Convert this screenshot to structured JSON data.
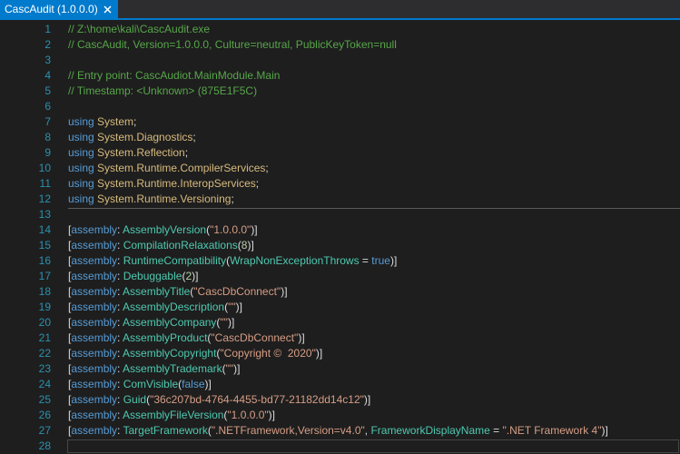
{
  "tab": {
    "title": "CascAudit (1.0.0.0)",
    "close_glyph": "✕"
  },
  "colors": {
    "accent": "#007acc",
    "background": "#1e1e1e",
    "line_number": "#2b91af",
    "comment": "#57a64a",
    "keyword": "#569cd6",
    "namespace": "#d7ba7d",
    "type": "#4ec9b0",
    "string": "#d69d85",
    "number": "#b5cea8",
    "text": "#dcdcdc"
  },
  "lines": [
    {
      "n": "1",
      "tokens": [
        {
          "c": "comment",
          "t": "// Z:\\home\\kali\\CascAudit.exe"
        }
      ]
    },
    {
      "n": "2",
      "tokens": [
        {
          "c": "comment",
          "t": "// CascAudit, Version=1.0.0.0, Culture=neutral, PublicKeyToken=null"
        }
      ]
    },
    {
      "n": "3",
      "tokens": []
    },
    {
      "n": "4",
      "tokens": [
        {
          "c": "comment",
          "t": "// Entry point: CascAudiot.MainModule.Main"
        }
      ]
    },
    {
      "n": "5",
      "tokens": [
        {
          "c": "comment",
          "t": "// Timestamp: <Unknown> (875E1F5C)"
        }
      ]
    },
    {
      "n": "6",
      "tokens": []
    },
    {
      "n": "7",
      "tokens": [
        {
          "c": "kw",
          "t": "using"
        },
        {
          "c": "text",
          "t": " "
        },
        {
          "c": "ns",
          "t": "System"
        },
        {
          "c": "text",
          "t": ";"
        }
      ]
    },
    {
      "n": "8",
      "tokens": [
        {
          "c": "kw",
          "t": "using"
        },
        {
          "c": "text",
          "t": " "
        },
        {
          "c": "ns",
          "t": "System.Diagnostics"
        },
        {
          "c": "text",
          "t": ";"
        }
      ]
    },
    {
      "n": "9",
      "tokens": [
        {
          "c": "kw",
          "t": "using"
        },
        {
          "c": "text",
          "t": " "
        },
        {
          "c": "ns",
          "t": "System.Reflection"
        },
        {
          "c": "text",
          "t": ";"
        }
      ]
    },
    {
      "n": "10",
      "tokens": [
        {
          "c": "kw",
          "t": "using"
        },
        {
          "c": "text",
          "t": " "
        },
        {
          "c": "ns",
          "t": "System.Runtime.CompilerServices"
        },
        {
          "c": "text",
          "t": ";"
        }
      ]
    },
    {
      "n": "11",
      "tokens": [
        {
          "c": "kw",
          "t": "using"
        },
        {
          "c": "text",
          "t": " "
        },
        {
          "c": "ns",
          "t": "System.Runtime.InteropServices"
        },
        {
          "c": "text",
          "t": ";"
        }
      ]
    },
    {
      "n": "12",
      "tokens": [
        {
          "c": "kw",
          "t": "using"
        },
        {
          "c": "text",
          "t": " "
        },
        {
          "c": "ns",
          "t": "System.Runtime.Versioning"
        },
        {
          "c": "text",
          "t": ";"
        }
      ]
    },
    {
      "n": "13",
      "tokens": []
    },
    {
      "n": "14",
      "tokens": [
        {
          "c": "text",
          "t": "["
        },
        {
          "c": "kw",
          "t": "assembly"
        },
        {
          "c": "text",
          "t": ": "
        },
        {
          "c": "type",
          "t": "AssemblyVersion"
        },
        {
          "c": "text",
          "t": "("
        },
        {
          "c": "str",
          "t": "\"1.0.0.0\""
        },
        {
          "c": "text",
          "t": ")]"
        }
      ]
    },
    {
      "n": "15",
      "tokens": [
        {
          "c": "text",
          "t": "["
        },
        {
          "c": "kw",
          "t": "assembly"
        },
        {
          "c": "text",
          "t": ": "
        },
        {
          "c": "type",
          "t": "CompilationRelaxations"
        },
        {
          "c": "text",
          "t": "("
        },
        {
          "c": "num",
          "t": "8"
        },
        {
          "c": "text",
          "t": ")]"
        }
      ]
    },
    {
      "n": "16",
      "tokens": [
        {
          "c": "text",
          "t": "["
        },
        {
          "c": "kw",
          "t": "assembly"
        },
        {
          "c": "text",
          "t": ": "
        },
        {
          "c": "type",
          "t": "RuntimeCompatibility"
        },
        {
          "c": "text",
          "t": "("
        },
        {
          "c": "type",
          "t": "WrapNonExceptionThrows"
        },
        {
          "c": "text",
          "t": " = "
        },
        {
          "c": "kw",
          "t": "true"
        },
        {
          "c": "text",
          "t": ")]"
        }
      ]
    },
    {
      "n": "17",
      "tokens": [
        {
          "c": "text",
          "t": "["
        },
        {
          "c": "kw",
          "t": "assembly"
        },
        {
          "c": "text",
          "t": ": "
        },
        {
          "c": "type",
          "t": "Debuggable"
        },
        {
          "c": "text",
          "t": "("
        },
        {
          "c": "num",
          "t": "2"
        },
        {
          "c": "text",
          "t": ")]"
        }
      ]
    },
    {
      "n": "18",
      "tokens": [
        {
          "c": "text",
          "t": "["
        },
        {
          "c": "kw",
          "t": "assembly"
        },
        {
          "c": "text",
          "t": ": "
        },
        {
          "c": "type",
          "t": "AssemblyTitle"
        },
        {
          "c": "text",
          "t": "("
        },
        {
          "c": "str",
          "t": "\"CascDbConnect\""
        },
        {
          "c": "text",
          "t": ")]"
        }
      ]
    },
    {
      "n": "19",
      "tokens": [
        {
          "c": "text",
          "t": "["
        },
        {
          "c": "kw",
          "t": "assembly"
        },
        {
          "c": "text",
          "t": ": "
        },
        {
          "c": "type",
          "t": "AssemblyDescription"
        },
        {
          "c": "text",
          "t": "("
        },
        {
          "c": "str",
          "t": "\"\""
        },
        {
          "c": "text",
          "t": ")]"
        }
      ]
    },
    {
      "n": "20",
      "tokens": [
        {
          "c": "text",
          "t": "["
        },
        {
          "c": "kw",
          "t": "assembly"
        },
        {
          "c": "text",
          "t": ": "
        },
        {
          "c": "type",
          "t": "AssemblyCompany"
        },
        {
          "c": "text",
          "t": "("
        },
        {
          "c": "str",
          "t": "\"\""
        },
        {
          "c": "text",
          "t": ")]"
        }
      ]
    },
    {
      "n": "21",
      "tokens": [
        {
          "c": "text",
          "t": "["
        },
        {
          "c": "kw",
          "t": "assembly"
        },
        {
          "c": "text",
          "t": ": "
        },
        {
          "c": "type",
          "t": "AssemblyProduct"
        },
        {
          "c": "text",
          "t": "("
        },
        {
          "c": "str",
          "t": "\"CascDbConnect\""
        },
        {
          "c": "text",
          "t": ")]"
        }
      ]
    },
    {
      "n": "22",
      "tokens": [
        {
          "c": "text",
          "t": "["
        },
        {
          "c": "kw",
          "t": "assembly"
        },
        {
          "c": "text",
          "t": ": "
        },
        {
          "c": "type",
          "t": "AssemblyCopyright"
        },
        {
          "c": "text",
          "t": "("
        },
        {
          "c": "str",
          "t": "\"Copyright ©  2020\""
        },
        {
          "c": "text",
          "t": ")]"
        }
      ]
    },
    {
      "n": "23",
      "tokens": [
        {
          "c": "text",
          "t": "["
        },
        {
          "c": "kw",
          "t": "assembly"
        },
        {
          "c": "text",
          "t": ": "
        },
        {
          "c": "type",
          "t": "AssemblyTrademark"
        },
        {
          "c": "text",
          "t": "("
        },
        {
          "c": "str",
          "t": "\"\""
        },
        {
          "c": "text",
          "t": ")]"
        }
      ]
    },
    {
      "n": "24",
      "tokens": [
        {
          "c": "text",
          "t": "["
        },
        {
          "c": "kw",
          "t": "assembly"
        },
        {
          "c": "text",
          "t": ": "
        },
        {
          "c": "type",
          "t": "ComVisible"
        },
        {
          "c": "text",
          "t": "("
        },
        {
          "c": "kw",
          "t": "false"
        },
        {
          "c": "text",
          "t": ")]"
        }
      ]
    },
    {
      "n": "25",
      "tokens": [
        {
          "c": "text",
          "t": "["
        },
        {
          "c": "kw",
          "t": "assembly"
        },
        {
          "c": "text",
          "t": ": "
        },
        {
          "c": "type",
          "t": "Guid"
        },
        {
          "c": "text",
          "t": "("
        },
        {
          "c": "str",
          "t": "\"36c207bd-4764-4455-bd77-21182dd14c12\""
        },
        {
          "c": "text",
          "t": ")]"
        }
      ]
    },
    {
      "n": "26",
      "tokens": [
        {
          "c": "text",
          "t": "["
        },
        {
          "c": "kw",
          "t": "assembly"
        },
        {
          "c": "text",
          "t": ": "
        },
        {
          "c": "type",
          "t": "AssemblyFileVersion"
        },
        {
          "c": "text",
          "t": "("
        },
        {
          "c": "str",
          "t": "\"1.0.0.0\""
        },
        {
          "c": "text",
          "t": ")]"
        }
      ]
    },
    {
      "n": "27",
      "tokens": [
        {
          "c": "text",
          "t": "["
        },
        {
          "c": "kw",
          "t": "assembly"
        },
        {
          "c": "text",
          "t": ": "
        },
        {
          "c": "type",
          "t": "TargetFramework"
        },
        {
          "c": "text",
          "t": "("
        },
        {
          "c": "str",
          "t": "\".NETFramework,Version=v4.0\""
        },
        {
          "c": "text",
          "t": ", "
        },
        {
          "c": "type",
          "t": "FrameworkDisplayName"
        },
        {
          "c": "text",
          "t": " = "
        },
        {
          "c": "str",
          "t": "\".NET Framework 4\""
        },
        {
          "c": "text",
          "t": ")]"
        }
      ]
    },
    {
      "n": "28",
      "tokens": []
    }
  ]
}
